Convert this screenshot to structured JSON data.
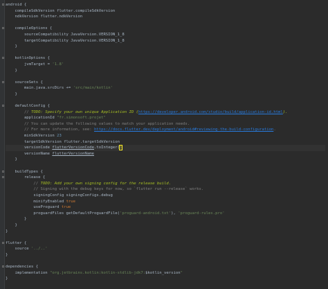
{
  "editor": {
    "lines": [
      [
        {
          "t": "android {",
          "c": "plain"
        }
      ],
      [
        {
          "t": "    compileSdkVersion flutter.compileSdkVersion",
          "c": "plain"
        }
      ],
      [
        {
          "t": "    ndkVersion flutter.ndkVersion",
          "c": "plain"
        }
      ],
      [],
      [
        {
          "t": "    compileOptions {",
          "c": "plain"
        }
      ],
      [
        {
          "t": "        sourceCompatibility JavaVersion.VERSION_1_8",
          "c": "plain"
        }
      ],
      [
        {
          "t": "        targetCompatibility JavaVersion.VERSION_1_8",
          "c": "plain"
        }
      ],
      [
        {
          "t": "    }",
          "c": "plain"
        }
      ],
      [],
      [
        {
          "t": "    kotlinOptions {",
          "c": "plain"
        }
      ],
      [
        {
          "t": "        jvmTarget = ",
          "c": "plain"
        },
        {
          "t": "'1.8'",
          "c": "string"
        }
      ],
      [
        {
          "t": "    }",
          "c": "plain"
        }
      ],
      [],
      [
        {
          "t": "    sourceSets {",
          "c": "plain"
        }
      ],
      [
        {
          "t": "        main.java.srcDirs += ",
          "c": "plain"
        },
        {
          "t": "'src/main/kotlin'",
          "c": "string"
        }
      ],
      [
        {
          "t": "    }",
          "c": "plain"
        }
      ],
      [],
      [
        {
          "t": "    defaultConfig {",
          "c": "plain"
        }
      ],
      [
        {
          "t": "        // ",
          "c": "comment"
        },
        {
          "t": "TODO: Specify your own unique Application ID (",
          "c": "todo"
        },
        {
          "t": "https://developer.android.com/studio/build/application-id.html",
          "c": "link"
        },
        {
          "t": ").",
          "c": "todo"
        }
      ],
      [
        {
          "t": "        applicationId ",
          "c": "plain"
        },
        {
          "t": "\"fr.simonsoft.projet\"",
          "c": "string"
        }
      ],
      [
        {
          "t": "        // You can update the following values to match your application needs.",
          "c": "comment"
        }
      ],
      [
        {
          "t": "        // For more information, see: ",
          "c": "comment"
        },
        {
          "t": "https://docs.flutter.dev/deployment/android#reviewing-the-build-configuration",
          "c": "link"
        },
        {
          "t": ".",
          "c": "comment"
        }
      ],
      [
        {
          "t": "        minSdkVersion ",
          "c": "plain"
        },
        {
          "t": "23",
          "c": "number"
        }
      ],
      [
        {
          "t": "        targetSdkVersion flutter.targetSdkVersion",
          "c": "plain"
        }
      ],
      [
        {
          "t": "        versionCode ",
          "c": "plain"
        },
        {
          "t": "flutterVersionCode",
          "c": "ident"
        },
        {
          "t": ".toInteger(",
          "c": "plain"
        },
        {
          "t": ")",
          "c": "brace-match"
        },
        {
          "t": "|",
          "c": "caret"
        }
      ],
      [
        {
          "t": "        versionName ",
          "c": "plain"
        },
        {
          "t": "flutterVersionName",
          "c": "ident"
        }
      ],
      [
        {
          "t": "    }",
          "c": "plain"
        }
      ],
      [],
      [
        {
          "t": "    buildTypes {",
          "c": "plain"
        }
      ],
      [
        {
          "t": "        release {",
          "c": "plain"
        }
      ],
      [
        {
          "t": "            // ",
          "c": "comment"
        },
        {
          "t": "TODO: Add your own signing config for the release build.",
          "c": "todo"
        }
      ],
      [
        {
          "t": "            // Signing with the debug keys for now, so `flutter run --release` works.",
          "c": "comment"
        }
      ],
      [
        {
          "t": "            signingConfig signingConfigs.debug",
          "c": "plain"
        }
      ],
      [
        {
          "t": "            minifyEnabled ",
          "c": "plain"
        },
        {
          "t": "true",
          "c": "keyword"
        }
      ],
      [
        {
          "t": "            useProguard ",
          "c": "plain"
        },
        {
          "t": "true",
          "c": "keyword"
        }
      ],
      [
        {
          "t": "            proguardFiles getDefaultProguardFile(",
          "c": "plain"
        },
        {
          "t": "'proguard-android.txt'",
          "c": "string"
        },
        {
          "t": "), ",
          "c": "plain"
        },
        {
          "t": "'proguard-rules.pro'",
          "c": "string"
        }
      ],
      [
        {
          "t": "        }",
          "c": "plain"
        }
      ],
      [
        {
          "t": "    }",
          "c": "plain"
        }
      ],
      [
        {
          "t": "}",
          "c": "plain"
        }
      ],
      [],
      [
        {
          "t": "flutter {",
          "c": "plain"
        }
      ],
      [
        {
          "t": "    source ",
          "c": "plain"
        },
        {
          "t": "'../..'",
          "c": "string"
        }
      ],
      [
        {
          "t": "}",
          "c": "plain"
        }
      ],
      [],
      [
        {
          "t": "dependencies {",
          "c": "plain"
        }
      ],
      [
        {
          "t": "    implementation ",
          "c": "plain"
        },
        {
          "t": "\"org.jetbrains.kotlin:kotlin-stdlib-jdk7:",
          "c": "string"
        },
        {
          "t": "$kotlin_version",
          "c": "plain"
        },
        {
          "t": "\"",
          "c": "string"
        }
      ],
      [
        {
          "t": "}",
          "c": "plain"
        }
      ]
    ],
    "highlight_line": 24,
    "fold_lines": [
      0,
      4,
      9,
      13,
      17,
      28,
      29,
      40,
      44
    ]
  },
  "colors": {
    "background": "#2b2b2b",
    "text": "#a9b7c6",
    "string": "#6a8759",
    "comment": "#808080",
    "todo": "#a8c023",
    "link": "#287bde",
    "keyword": "#cc7832",
    "number": "#6897bb"
  }
}
